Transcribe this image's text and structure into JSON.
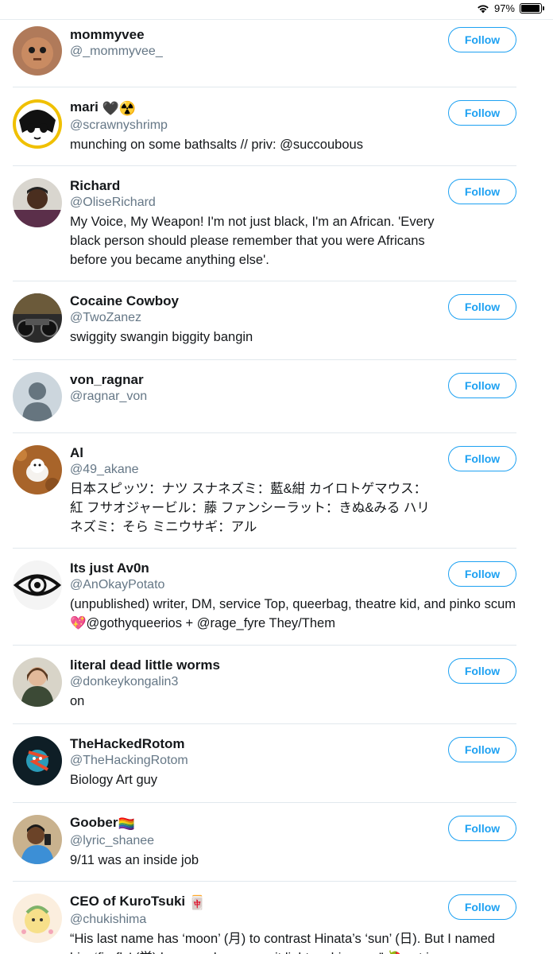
{
  "status_bar": {
    "battery": "97%",
    "battery_level": 0.97
  },
  "follow_label": "Follow",
  "users": [
    {
      "name": "mommyvee",
      "handle": "@_mommyvee_",
      "bio": ""
    },
    {
      "name": "mari",
      "name_suffix": "🖤☢️",
      "handle": "@scrawnyshrimp",
      "bio": "munching on some bathsalts // priv: @succoubous"
    },
    {
      "name": "Richard",
      "handle": "@OliseRichard",
      "bio": "My Voice, My Weapon! I'm not just black, I'm an African. 'Every black person should please remember that you were Africans before you became anything else'."
    },
    {
      "name": "Cocaine Cowboy",
      "handle": "@TwoZanez",
      "bio": "swiggity swangin biggity bangin"
    },
    {
      "name": "von_ragnar",
      "handle": "@ragnar_von",
      "bio": ""
    },
    {
      "name": "Al",
      "handle": "@49_akane",
      "bio": "日本スピッツ：ナツ スナネズミ：藍&紺 カイロトゲマウス：紅 フサオジャービル：藤 ファンシーラット：きぬ&みる ハリネズミ：そら ミニウサギ：アル"
    },
    {
      "name": "Its just Av0n",
      "handle": "@AnOkayPotato",
      "bio": "(unpublished) writer, DM, service Top, queerbag, theatre kid, and pinko scum 💖@gothyqueerios + @rage_fyre They/Them"
    },
    {
      "name": "literal dead little worms",
      "handle": "@donkeykongalin3",
      "bio": "on"
    },
    {
      "name": "TheHackedRotom",
      "handle": "@TheHackingRotom",
      "bio": "Biology Art guy"
    },
    {
      "name": "Goober",
      "name_suffix": "🏳️‍🌈",
      "handle": "@lyric_shanee",
      "bio": "9/11 was an inside job"
    },
    {
      "name": "CEO of KuroTsuki",
      "name_suffix": "🀄",
      "handle": "@chukishima",
      "bio": "“His last name has ‘moon’ (月) to contrast Hinata’s ‘sun’ (日). But I named him ‘firefly’ (蛍) because he can emit light on his own.” 🍓 art in"
    }
  ]
}
